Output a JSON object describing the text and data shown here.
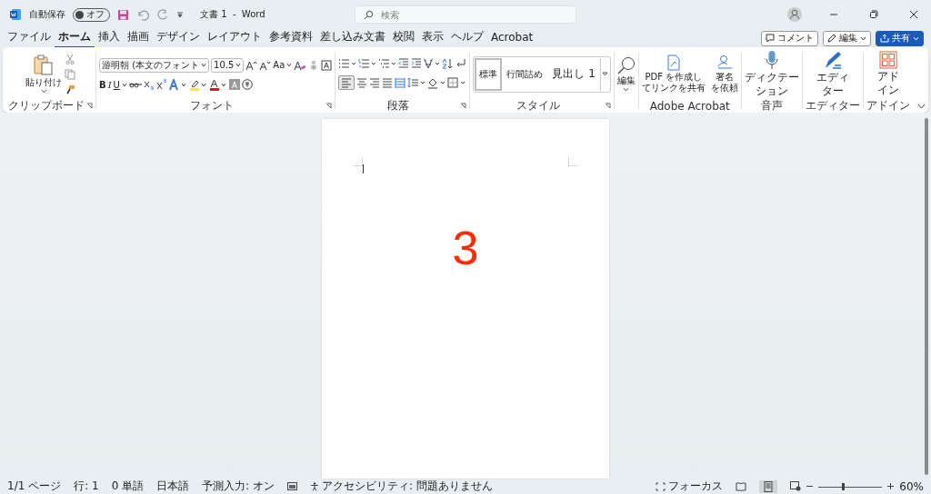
{
  "title_bar": {
    "autosave_label": "自動保存",
    "autosave": {
      "on": false,
      "label": "オフ"
    },
    "title": "文書 1  -  Word",
    "search": {
      "placeholder": "検索"
    }
  },
  "tabs": [
    {
      "label": "ファイル",
      "selected": false
    },
    {
      "label": "ホーム",
      "selected": true
    },
    {
      "label": "挿入",
      "selected": false
    },
    {
      "label": "描画",
      "selected": false
    },
    {
      "label": "デザイン",
      "selected": false
    },
    {
      "label": "レイアウト",
      "selected": false
    },
    {
      "label": "参考資料",
      "selected": false
    },
    {
      "label": "差し込み文書",
      "selected": false
    },
    {
      "label": "校閲",
      "selected": false
    },
    {
      "label": "表示",
      "selected": false
    },
    {
      "label": "ヘルプ",
      "selected": false
    },
    {
      "label": "Acrobat",
      "selected": false
    }
  ],
  "ribbon_actions": {
    "comment": "コメント",
    "edit": "編集",
    "share": "共有"
  },
  "clipboard": {
    "paste": "貼り付け",
    "label": "クリップボード"
  },
  "font": {
    "name": "游明朝 (本文のフォント",
    "size": "10.5",
    "case_button": "Aa",
    "bold": "B",
    "italic": "I",
    "underline": "U",
    "label": "フォント"
  },
  "paragraph": {
    "label": "段落"
  },
  "styles": {
    "items": [
      {
        "label": "標準",
        "selected": true
      },
      {
        "label": "行間詰め",
        "selected": false
      },
      {
        "label": "見出し 1",
        "selected": false
      }
    ],
    "label": "スタイル"
  },
  "editing": {
    "label": "編集"
  },
  "acrobat": {
    "buttons": [
      {
        "lines": [
          "PDF を作成し",
          "てリンクを共有"
        ]
      },
      {
        "lines": [
          "署名",
          "を依頼"
        ]
      }
    ],
    "label": "Adobe Acrobat"
  },
  "voice": {
    "lines": [
      "ディクテー",
      "ション"
    ],
    "label": "音声"
  },
  "editor": {
    "lines": [
      "エディ",
      "ター"
    ],
    "label": "エディター"
  },
  "addins": {
    "lines": [
      "アド",
      "イン"
    ],
    "label": "アドイン"
  },
  "document": {
    "text": "3"
  },
  "status_bar": {
    "items": [
      "1/1 ページ",
      "行: 1",
      "0 単語",
      "日本語",
      "予測入力: オン"
    ],
    "accessibility": "アクセシビリティ: 問題ありません",
    "focus": "フォーカス",
    "zoom": {
      "level": 0.38,
      "label": "60%"
    }
  }
}
